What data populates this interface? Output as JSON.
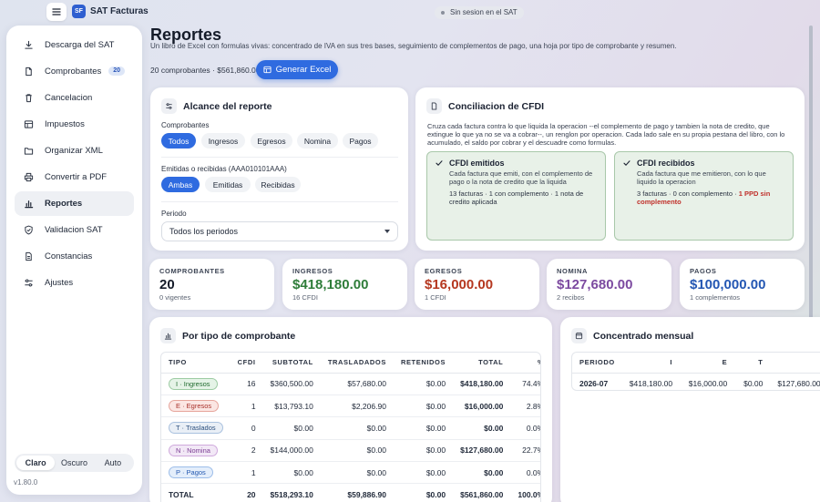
{
  "app": {
    "title": "SAT Facturas",
    "logo": "SF",
    "session": "Sin sesion en el SAT",
    "version": "v1.80.0"
  },
  "sidebar": {
    "items": [
      {
        "label": "Descarga del SAT",
        "icon": "download-icon"
      },
      {
        "label": "Comprobantes",
        "icon": "document-icon",
        "badge": "20"
      },
      {
        "label": "Cancelacion",
        "icon": "trash-icon"
      },
      {
        "label": "Impuestos",
        "icon": "table-icon"
      },
      {
        "label": "Organizar XML",
        "icon": "folder-icon"
      },
      {
        "label": "Convertir a PDF",
        "icon": "printer-icon"
      },
      {
        "label": "Reportes",
        "icon": "bar-chart-icon",
        "active": true
      },
      {
        "label": "Validacion SAT",
        "icon": "shield-check-icon"
      },
      {
        "label": "Constancias",
        "icon": "file-text-icon"
      },
      {
        "label": "Ajustes",
        "icon": "sliders-icon"
      }
    ],
    "theme": {
      "options": [
        "Claro",
        "Oscuro",
        "Auto"
      ],
      "selected": "Claro"
    }
  },
  "header": {
    "title": "Reportes",
    "subtitle": "Un libro de Excel con formulas vivas: concentrado de IVA en sus tres bases, seguimiento de complementos de pago, una hoja por tipo de comprobante y resumen.",
    "summary": "20 comprobantes · $561,860.00",
    "generate_label": "Generar Excel"
  },
  "alcance": {
    "title": "Alcance del reporte",
    "comprobantes_label": "Comprobantes",
    "comprobantes_options": [
      "Todos",
      "Ingresos",
      "Egresos",
      "Nomina",
      "Pagos"
    ],
    "comprobantes_selected": "Todos",
    "emitidas_label": "Emitidas o recibidas (AAA010101AAA)",
    "emitidas_options": [
      "Ambas",
      "Emitidas",
      "Recibidas"
    ],
    "emitidas_selected": "Ambas",
    "periodo_label": "Periodo",
    "periodo_value": "Todos los periodos"
  },
  "conciliacion": {
    "title": "Conciliacion de CFDI",
    "description": "Cruza cada factura contra lo que liquida la operacion --el complemento de pago y tambien la nota de credito, que extingue lo que ya no se va a cobrar--, un renglon por operacion. Cada lado sale en su propia pestana del libro, con lo acumulado, el saldo por cobrar y el descuadre como formulas.",
    "emitidos": {
      "title": "CFDI emitidos",
      "text": "Cada factura que emiti, con el complemento de pago o la nota de credito que la liquida",
      "stat": "13 facturas · 1 con complemento · 1 nota de credito aplicada"
    },
    "recibidos": {
      "title": "CFDI recibidos",
      "text": "Cada factura que me emitieron, con lo que liquido la operacion",
      "stat": "3 facturas · 0 con complemento · ",
      "stat_warn": "1 PPD sin complemento"
    }
  },
  "stats": [
    {
      "label": "COMPROBANTES",
      "value": "20",
      "sub": "0 vigentes",
      "color": "#141b29"
    },
    {
      "label": "INGRESOS",
      "value": "$418,180.00",
      "sub": "16 CFDI",
      "color": "#2f7d3a"
    },
    {
      "label": "EGRESOS",
      "value": "$16,000.00",
      "sub": "1 CFDI",
      "color": "#b5371f"
    },
    {
      "label": "NOMINA",
      "value": "$127,680.00",
      "sub": "2 recibos",
      "color": "#7c4aa0"
    },
    {
      "label": "PAGOS",
      "value": "$100,000.00",
      "sub": "1 complementos",
      "color": "#2457b3"
    }
  ],
  "por_tipo": {
    "title": "Por tipo de comprobante",
    "headers": [
      "TIPO",
      "CFDI",
      "SUBTOTAL",
      "TRASLADADOS",
      "RETENIDOS",
      "TOTAL",
      "%"
    ],
    "rows": [
      {
        "tipo": "I · Ingresos",
        "pill": "g",
        "cfdi": "16",
        "subtotal": "$360,500.00",
        "trasladados": "$57,680.00",
        "retenidos": "$0.00",
        "total": "$418,180.00",
        "pct": "74.4%"
      },
      {
        "tipo": "E · Egresos",
        "pill": "r",
        "cfdi": "1",
        "subtotal": "$13,793.10",
        "trasladados": "$2,206.90",
        "retenidos": "$0.00",
        "total": "$16,000.00",
        "pct": "2.8%"
      },
      {
        "tipo": "T · Traslados",
        "pill": "gr",
        "cfdi": "0",
        "subtotal": "$0.00",
        "trasladados": "$0.00",
        "retenidos": "$0.00",
        "total": "$0.00",
        "pct": "0.0%"
      },
      {
        "tipo": "N · Nomina",
        "pill": "p",
        "cfdi": "2",
        "subtotal": "$144,000.00",
        "trasladados": "$0.00",
        "retenidos": "$0.00",
        "total": "$127,680.00",
        "pct": "22.7%"
      },
      {
        "tipo": "P · Pagos",
        "pill": "b",
        "cfdi": "1",
        "subtotal": "$0.00",
        "trasladados": "$0.00",
        "retenidos": "$0.00",
        "total": "$0.00",
        "pct": "0.0%"
      }
    ],
    "total_row": {
      "tipo": "TOTAL",
      "cfdi": "20",
      "subtotal": "$518,293.10",
      "trasladados": "$59,886.90",
      "retenidos": "$0.00",
      "total": "$561,860.00",
      "pct": "100.0%"
    }
  },
  "mensual": {
    "title": "Concentrado mensual",
    "headers": [
      "PERIODO",
      "I",
      "E",
      "T"
    ],
    "rows": [
      {
        "periodo": "2026-07",
        "i": "$418,180.00",
        "e": "$16,000.00",
        "t": "$0.00",
        "extra": "$127,680.00"
      }
    ]
  }
}
